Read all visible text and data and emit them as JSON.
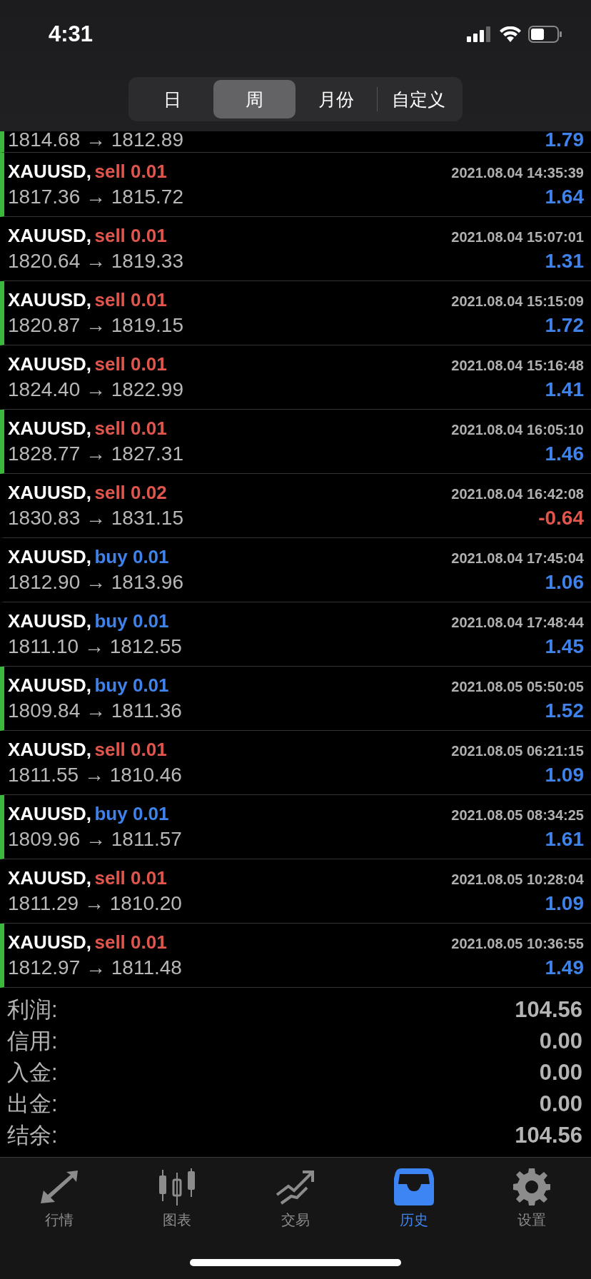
{
  "status_bar": {
    "time": "4:31"
  },
  "period_tabs": [
    {
      "label": "日",
      "selected": false
    },
    {
      "label": "周",
      "selected": true
    },
    {
      "label": "月份",
      "selected": false
    },
    {
      "label": "自定义",
      "selected": false
    }
  ],
  "partial_row": {
    "prices": "1814.68 → 1812.89",
    "profit": "1.79",
    "marked": true,
    "loss": false
  },
  "trades": [
    {
      "symbol": "XAUUSD,",
      "order": "sell 0.01",
      "kind": "sell",
      "time": "2021.08.04 14:35:39",
      "prices": "1817.36 → 1815.72",
      "profit": "1.64",
      "loss": false,
      "marked": true
    },
    {
      "symbol": "XAUUSD,",
      "order": "sell 0.01",
      "kind": "sell",
      "time": "2021.08.04 15:07:01",
      "prices": "1820.64 → 1819.33",
      "profit": "1.31",
      "loss": false,
      "marked": false
    },
    {
      "symbol": "XAUUSD,",
      "order": "sell 0.01",
      "kind": "sell",
      "time": "2021.08.04 15:15:09",
      "prices": "1820.87 → 1819.15",
      "profit": "1.72",
      "loss": false,
      "marked": true
    },
    {
      "symbol": "XAUUSD,",
      "order": "sell 0.01",
      "kind": "sell",
      "time": "2021.08.04 15:16:48",
      "prices": "1824.40 → 1822.99",
      "profit": "1.41",
      "loss": false,
      "marked": false
    },
    {
      "symbol": "XAUUSD,",
      "order": "sell 0.01",
      "kind": "sell",
      "time": "2021.08.04 16:05:10",
      "prices": "1828.77 → 1827.31",
      "profit": "1.46",
      "loss": false,
      "marked": true
    },
    {
      "symbol": "XAUUSD,",
      "order": "sell 0.02",
      "kind": "sell",
      "time": "2021.08.04 16:42:08",
      "prices": "1830.83 → 1831.15",
      "profit": "-0.64",
      "loss": true,
      "marked": false
    },
    {
      "symbol": "XAUUSD,",
      "order": "buy 0.01",
      "kind": "buy",
      "time": "2021.08.04 17:45:04",
      "prices": "1812.90 → 1813.96",
      "profit": "1.06",
      "loss": false,
      "marked": false
    },
    {
      "symbol": "XAUUSD,",
      "order": "buy 0.01",
      "kind": "buy",
      "time": "2021.08.04 17:48:44",
      "prices": "1811.10 → 1812.55",
      "profit": "1.45",
      "loss": false,
      "marked": false
    },
    {
      "symbol": "XAUUSD,",
      "order": "buy 0.01",
      "kind": "buy",
      "time": "2021.08.05 05:50:05",
      "prices": "1809.84 → 1811.36",
      "profit": "1.52",
      "loss": false,
      "marked": true
    },
    {
      "symbol": "XAUUSD,",
      "order": "sell 0.01",
      "kind": "sell",
      "time": "2021.08.05 06:21:15",
      "prices": "1811.55 → 1810.46",
      "profit": "1.09",
      "loss": false,
      "marked": false
    },
    {
      "symbol": "XAUUSD,",
      "order": "buy 0.01",
      "kind": "buy",
      "time": "2021.08.05 08:34:25",
      "prices": "1809.96 → 1811.57",
      "profit": "1.61",
      "loss": false,
      "marked": true
    },
    {
      "symbol": "XAUUSD,",
      "order": "sell 0.01",
      "kind": "sell",
      "time": "2021.08.05 10:28:04",
      "prices": "1811.29 → 1810.20",
      "profit": "1.09",
      "loss": false,
      "marked": false
    },
    {
      "symbol": "XAUUSD,",
      "order": "sell 0.01",
      "kind": "sell",
      "time": "2021.08.05 10:36:55",
      "prices": "1812.97 → 1811.48",
      "profit": "1.49",
      "loss": false,
      "marked": true
    }
  ],
  "summary": [
    {
      "label": "利润:",
      "value": "104.56"
    },
    {
      "label": "信用:",
      "value": "0.00"
    },
    {
      "label": "入金:",
      "value": "0.00"
    },
    {
      "label": "出金:",
      "value": "0.00"
    },
    {
      "label": "结余:",
      "value": "104.56"
    }
  ],
  "bottom_tabs": [
    {
      "label": "行情",
      "selected": false
    },
    {
      "label": "图表",
      "selected": false
    },
    {
      "label": "交易",
      "selected": false
    },
    {
      "label": "历史",
      "selected": true
    },
    {
      "label": "设置",
      "selected": false
    }
  ]
}
